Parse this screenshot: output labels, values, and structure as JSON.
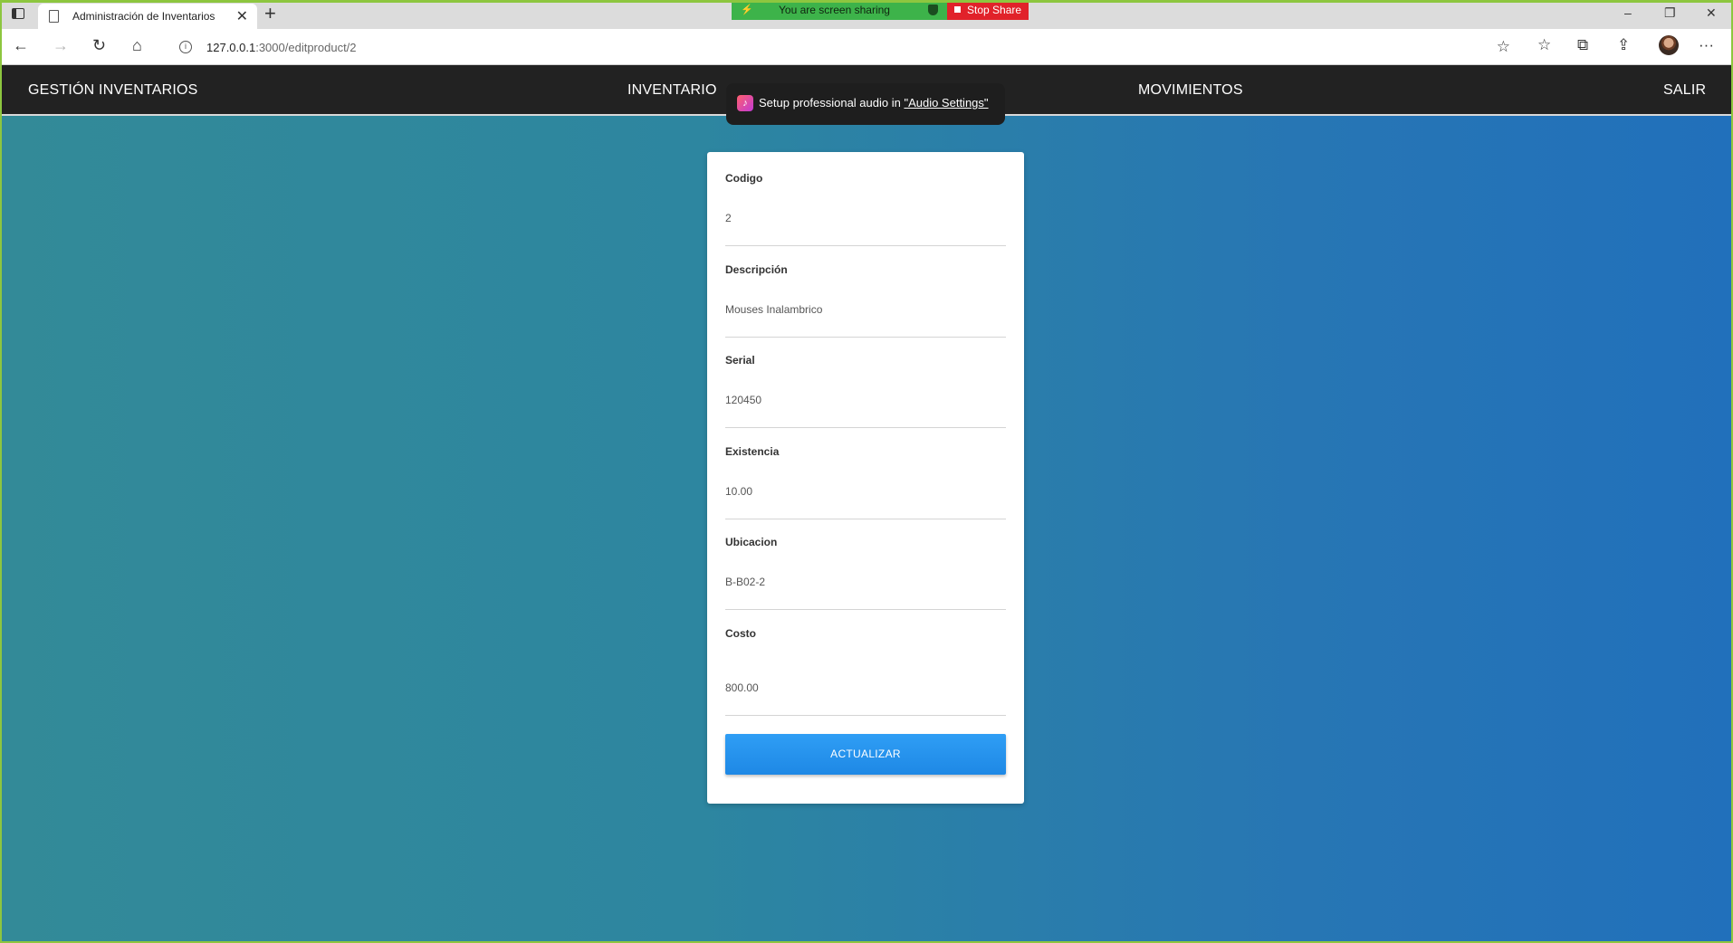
{
  "browser": {
    "tab_title": "Administración de Inventarios",
    "tab_close": "✕",
    "new_tab": "+",
    "url_host": "127.0.0.1",
    "url_path": ":3000/editproduct/2",
    "window_controls": [
      "–",
      "❐",
      "✕"
    ]
  },
  "screen_share": {
    "status_text": "You are screen sharing",
    "stop_label": "Stop Share",
    "status_color": "#3db34a",
    "stop_color": "#e1222a"
  },
  "audio_toast": {
    "text": "Setup professional audio in ",
    "link": "\"Audio Settings\""
  },
  "navbar": {
    "brand": "GESTIÓN INVENTARIOS",
    "items": [
      "INVENTARIO",
      "MOVIMIENTOS",
      "SALIR"
    ]
  },
  "form": {
    "fields": [
      {
        "label": "Codigo",
        "value": "2"
      },
      {
        "label": "Descripción",
        "value": "Mouses Inalambrico"
      },
      {
        "label": "Serial",
        "value": "120450"
      },
      {
        "label": "Existencia",
        "value": "10.00"
      },
      {
        "label": "Ubicacion",
        "value": "B-B02-2"
      },
      {
        "label": "Costo",
        "value": "800.00"
      }
    ],
    "submit_label": "ACTUALIZAR",
    "accent": "#1e88e5"
  },
  "icons": {
    "back": "←",
    "forward": "→",
    "refresh": "↻",
    "home": "⌂",
    "star": "☆",
    "favorites": "☆",
    "collections": "⧉",
    "share": "⇪",
    "more": "···"
  }
}
